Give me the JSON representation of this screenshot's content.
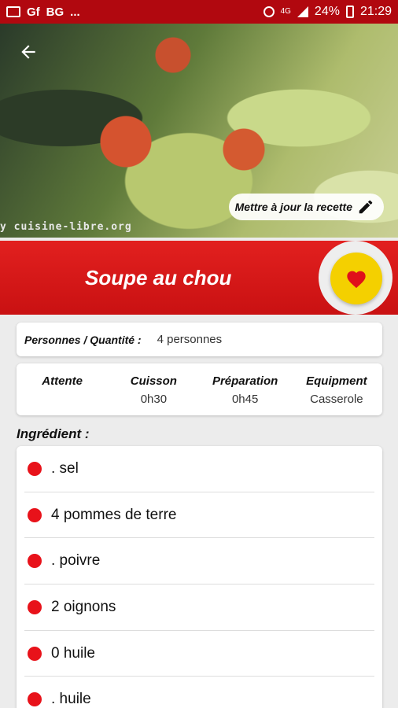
{
  "status_bar": {
    "left_icons": [
      "image-icon",
      "gf-icon",
      "bg-icon"
    ],
    "left_labels": [
      "Gf",
      "BG",
      "..."
    ],
    "network": "4G",
    "battery": "24%",
    "time": "21:29"
  },
  "hero": {
    "watermark": "y cuisine-libre.org",
    "update_button": "Mettre à jour la recette"
  },
  "recipe": {
    "title": "Soupe au chou"
  },
  "persons": {
    "label": "Personnes / Quantité :",
    "value": "4 personnes"
  },
  "times": [
    {
      "header": "Attente",
      "value": ""
    },
    {
      "header": "Cuisson",
      "value": "0h30"
    },
    {
      "header": "Préparation",
      "value": "0h45"
    },
    {
      "header": "Equipment",
      "value": "Casserole"
    }
  ],
  "ingredients": {
    "title": "Ingrédient :",
    "items": [
      ". sel",
      "4 pommes de terre",
      ". poivre",
      "2 oignons",
      "0 huile",
      ". huile"
    ]
  },
  "colors": {
    "status_bar": "#b1080f",
    "title_band": "#d81718",
    "favorite": "#f4d000",
    "bullet": "#e8121a"
  }
}
